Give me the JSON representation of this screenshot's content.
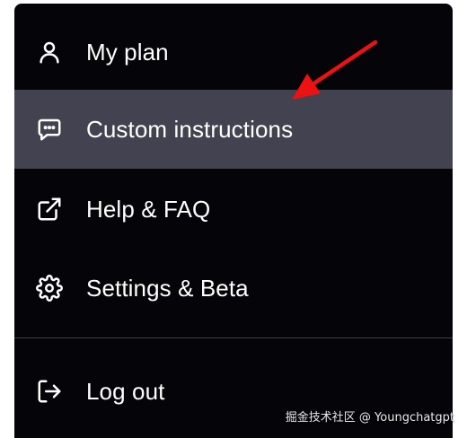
{
  "menu": {
    "items": [
      {
        "label": "My plan",
        "icon": "user-icon",
        "active": false
      },
      {
        "label": "Custom instructions",
        "icon": "chat-bubble-icon",
        "active": true
      },
      {
        "label": "Help & FAQ",
        "icon": "external-link-icon",
        "active": false
      },
      {
        "label": "Settings & Beta",
        "icon": "gear-icon",
        "active": false
      }
    ],
    "logout": {
      "label": "Log out",
      "icon": "logout-icon"
    }
  },
  "watermark": "掘金技术社区 @ Youngchatgpt",
  "colors": {
    "menu_background": "#050509",
    "active_background": "#424250",
    "text": "#ffffff",
    "arrow": "#ee1111"
  }
}
